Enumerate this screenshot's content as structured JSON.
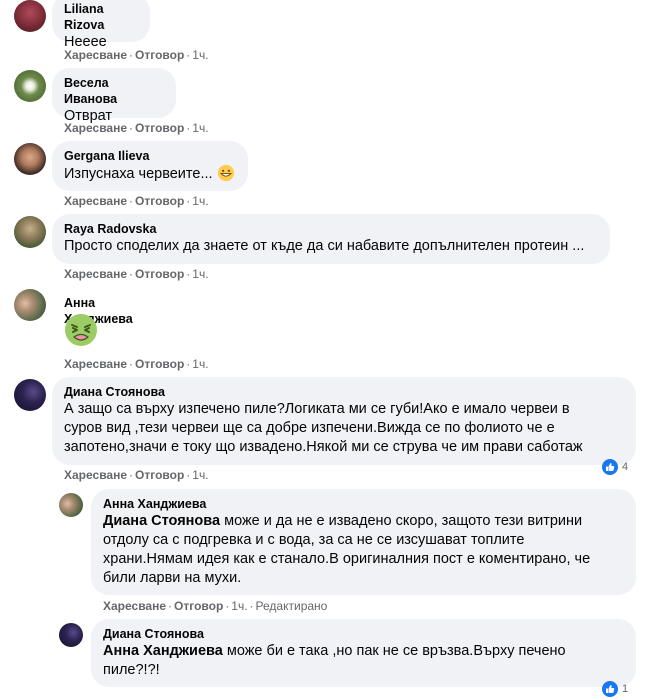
{
  "labels": {
    "like": "Харесване",
    "reply": "Отговор",
    "separator": "·"
  },
  "comments": [
    {
      "author": "Liliana Rizova",
      "text": "Нееее",
      "time": "1ч."
    },
    {
      "author": "Весела Иванова",
      "text": "Отврат",
      "time": "1ч."
    },
    {
      "author": "Gergana Ilieva",
      "text": "Изпуснаха червеите...",
      "emoji": "grinning-face-emoji",
      "time": "1ч."
    },
    {
      "author": "Raya Radovska",
      "text": "Просто споделих да знаете от къде да си набавите допълнителен протеин ...",
      "time": "1ч."
    },
    {
      "author": "Анна Ханджиева",
      "emoji": "nauseated-face-emoji",
      "time": "1ч."
    },
    {
      "author": "Диана Стоянова",
      "lines": [
        "А защо са върху изпечено пиле?Логиката ми се губи!Ако е имало червеи в",
        "суров вид ,тези червеи ще са добре изпечени.Вижда се по фолиото че е",
        "запотено,значи е току що извадено.Някой ми се струва че им прави саботаж"
      ],
      "time": "1ч.",
      "reactions": "4"
    }
  ],
  "replies": [
    {
      "author": "Анна Ханджиева",
      "mention": "Диана Стоянова",
      "first_line": " може и да не е извадено скоро, защото тези витрини",
      "lines": [
        "отдолу са с подгревка и с вода, за са не се изсушават топлите",
        "храни.Нямам идея как е станало.В оригиналния пост е коментирано, че",
        "били ларви на мухи."
      ],
      "time": "1ч.",
      "edited": "Редактирано"
    },
    {
      "author": "Диана Стоянова",
      "mention": "Анна Ханджиева",
      "first_line": " може би е така ,но пак не се връзва.Върху печено",
      "lines": [
        "пиле?!?!"
      ],
      "reactions": "1"
    }
  ],
  "colors": {
    "bubble": "#f0f2f5",
    "meta": "#65676b",
    "like_blue": "#1877f2"
  }
}
